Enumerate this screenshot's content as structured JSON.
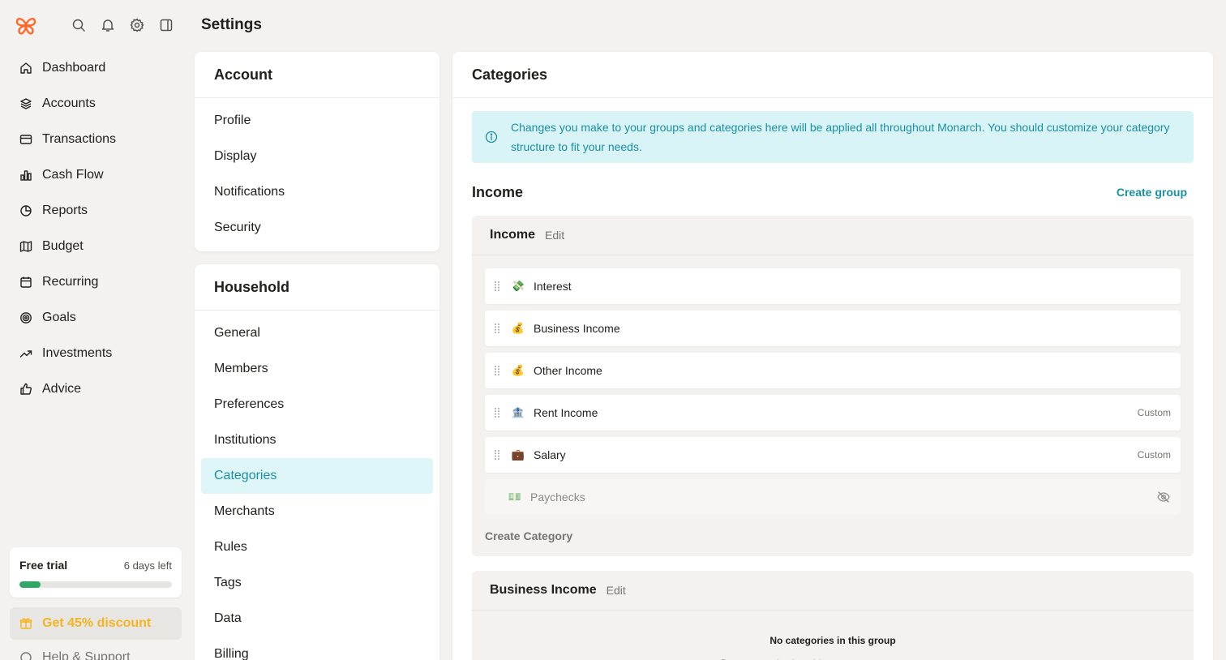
{
  "app": {
    "page_title": "Settings"
  },
  "colors": {
    "accent": "#1a8fa3",
    "brand": "#ff692d",
    "trial_bar": "#2fa866",
    "discount": "#f5b522"
  },
  "sidebar": {
    "top_icons": [
      "search-icon",
      "bell-icon",
      "gear-icon",
      "panel-toggle-icon"
    ],
    "items": [
      {
        "label": "Dashboard",
        "icon": "home-icon"
      },
      {
        "label": "Accounts",
        "icon": "layers-icon"
      },
      {
        "label": "Transactions",
        "icon": "credit-card-icon"
      },
      {
        "label": "Cash Flow",
        "icon": "bar-chart-icon"
      },
      {
        "label": "Reports",
        "icon": "pie-chart-icon"
      },
      {
        "label": "Budget",
        "icon": "map-icon"
      },
      {
        "label": "Recurring",
        "icon": "calendar-icon"
      },
      {
        "label": "Goals",
        "icon": "target-icon"
      },
      {
        "label": "Investments",
        "icon": "trending-up-icon"
      },
      {
        "label": "Advice",
        "icon": "thumbs-up-icon"
      }
    ],
    "trial": {
      "title": "Free trial",
      "days_left": "6 days left",
      "progress": 0.14
    },
    "discount_label": "Get 45% discount",
    "help_label": "Help & Support"
  },
  "settings_menu": {
    "account": {
      "title": "Account",
      "items": [
        "Profile",
        "Display",
        "Notifications",
        "Security"
      ]
    },
    "household": {
      "title": "Household",
      "items": [
        "General",
        "Members",
        "Preferences",
        "Institutions",
        "Categories",
        "Merchants",
        "Rules",
        "Tags",
        "Data",
        "Billing"
      ],
      "active": "Categories"
    }
  },
  "main": {
    "title": "Categories",
    "info_text": "Changes you make to your groups and categories here will be applied all throughout Monarch. You should customize your category structure to fit your needs.",
    "section_title": "Income",
    "create_group_label": "Create group",
    "groups": [
      {
        "name": "Income",
        "edit_label": "Edit",
        "categories": [
          {
            "emoji": "💸",
            "name": "Interest",
            "tag": ""
          },
          {
            "emoji": "💰",
            "name": "Business Income",
            "tag": ""
          },
          {
            "emoji": "💰",
            "name": "Other Income",
            "tag": ""
          },
          {
            "emoji": "🏦",
            "name": "Rent Income",
            "tag": "Custom"
          },
          {
            "emoji": "💼",
            "name": "Salary",
            "tag": "Custom"
          }
        ],
        "hidden_category": {
          "emoji": "💵",
          "name": "Paychecks"
        },
        "create_category_label": "Create Category"
      },
      {
        "name": "Business Income",
        "edit_label": "Edit",
        "empty_message": "No categories in this group",
        "empty_sub": "Drag categories into this group, or create a new one"
      }
    ]
  }
}
